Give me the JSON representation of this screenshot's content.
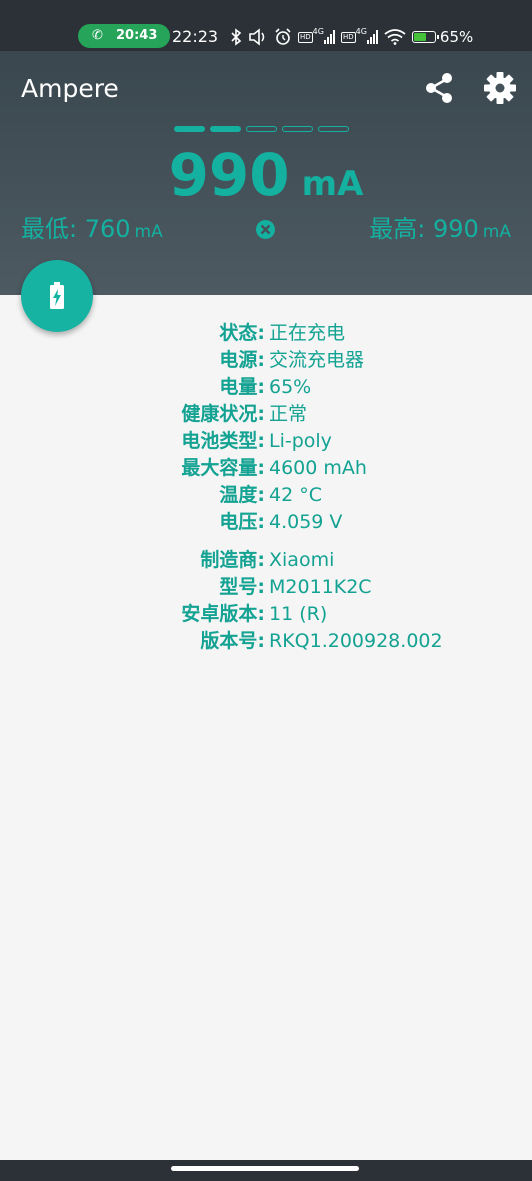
{
  "status_bar": {
    "call_time": "20:43",
    "clock": "22:23",
    "battery_percent": "65%",
    "battery_level": 0.65,
    "network_badge": "HD",
    "network_type": "4G",
    "icons": [
      "phone-icon",
      "bluetooth-icon",
      "volume-icon",
      "alarm-icon",
      "signal-icon",
      "wifi-icon",
      "battery-charging-icon"
    ]
  },
  "header": {
    "app_title": "Ampere",
    "share_icon": "share-icon",
    "settings_icon": "gear-icon",
    "level_segments_filled": 2,
    "level_segments_total": 5,
    "current_value": "990",
    "current_unit": "mA",
    "min_label": "最低: 760",
    "min_unit": "mA",
    "max_label": "最高: 990",
    "max_unit": "mA",
    "reset_icon": "close-circle-icon",
    "fab_icon": "battery-charging-icon",
    "accent_color": "#14b0a0"
  },
  "info": {
    "battery_rows": [
      {
        "label": "状态:",
        "value": "正在充电"
      },
      {
        "label": "电源:",
        "value": "交流充电器"
      },
      {
        "label": "电量:",
        "value": "65%"
      },
      {
        "label": "健康状况:",
        "value": "正常"
      },
      {
        "label": "电池类型:",
        "value": "Li-poly"
      },
      {
        "label": "最大容量:",
        "value": "4600 mAh"
      },
      {
        "label": "温度:",
        "value": "42 °C"
      },
      {
        "label": "电压:",
        "value": "4.059 V"
      }
    ],
    "device_rows": [
      {
        "label": "制造商:",
        "value": "Xiaomi"
      },
      {
        "label": "型号:",
        "value": "M2011K2C"
      },
      {
        "label": "安卓版本:",
        "value": "11 (R)"
      },
      {
        "label": "版本号:",
        "value": "RKQ1.200928.002"
      }
    ]
  }
}
